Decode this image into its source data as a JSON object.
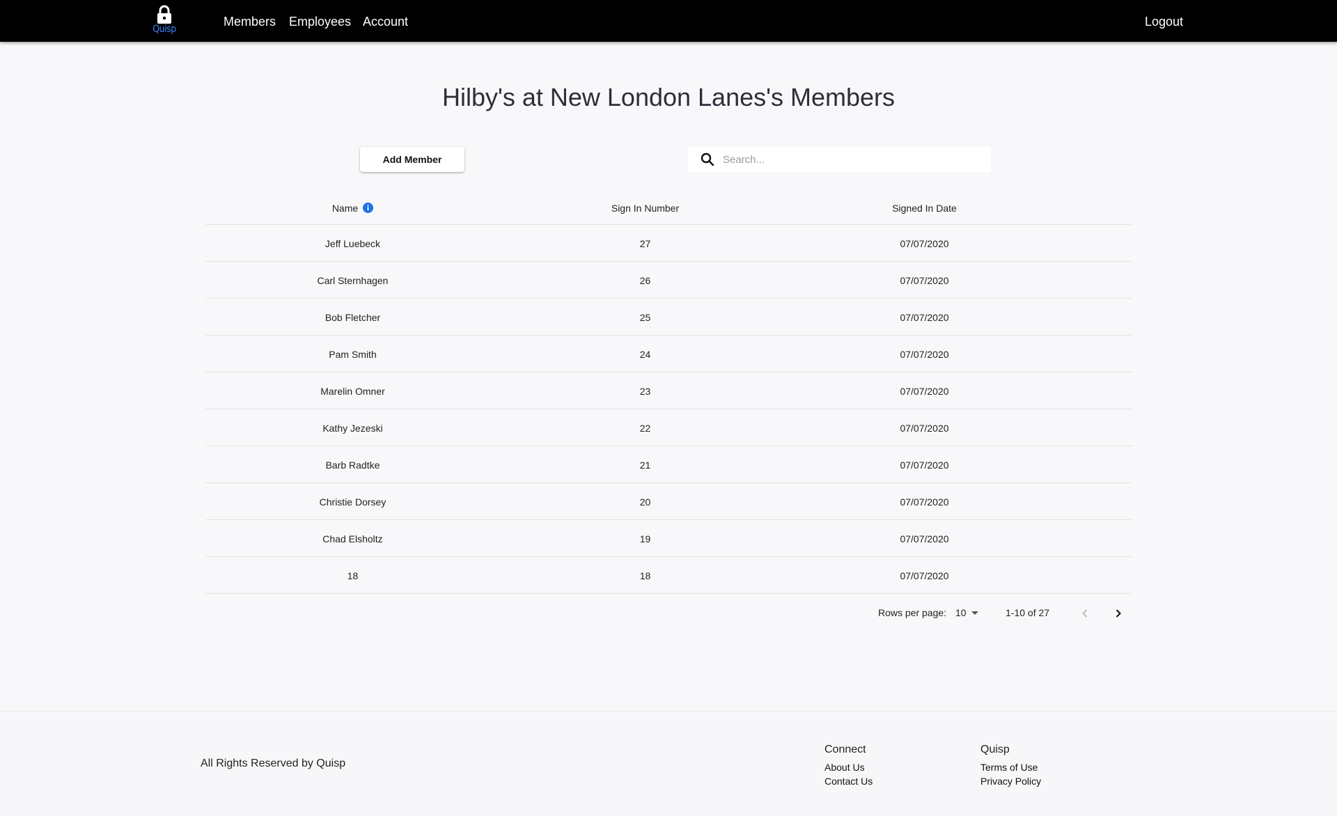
{
  "nav": {
    "logo_text": "Quisp",
    "links": [
      "Members",
      "Employees",
      "Account"
    ],
    "logout_label": "Logout"
  },
  "page": {
    "title": "Hilby's at New London Lanes's Members",
    "add_button_label": "Add Member",
    "search_placeholder": "Search..."
  },
  "table": {
    "headers": {
      "name": "Name",
      "sign_in_number": "Sign In Number",
      "signed_in_date": "Signed In Date"
    },
    "rows": [
      {
        "name": "Jeff Luebeck",
        "number": "27",
        "date": "07/07/2020"
      },
      {
        "name": "Carl Sternhagen",
        "number": "26",
        "date": "07/07/2020"
      },
      {
        "name": "Bob Fletcher",
        "number": "25",
        "date": "07/07/2020"
      },
      {
        "name": "Pam Smith",
        "number": "24",
        "date": "07/07/2020"
      },
      {
        "name": "Marelin Omner",
        "number": "23",
        "date": "07/07/2020"
      },
      {
        "name": "Kathy Jezeski",
        "number": "22",
        "date": "07/07/2020"
      },
      {
        "name": "Barb Radtke",
        "number": "21",
        "date": "07/07/2020"
      },
      {
        "name": "Christie Dorsey",
        "number": "20",
        "date": "07/07/2020"
      },
      {
        "name": "Chad Elsholtz",
        "number": "19",
        "date": "07/07/2020"
      },
      {
        "name": "18",
        "number": "18",
        "date": "07/07/2020"
      }
    ]
  },
  "pagination": {
    "rows_per_page_label": "Rows per page:",
    "rows_per_page_value": "10",
    "range_text": "1-10 of 27"
  },
  "footer": {
    "copyright": "All Rights Reserved by Quisp",
    "connect_heading": "Connect",
    "connect_links": [
      "About Us",
      "Contact Us"
    ],
    "quisp_heading": "Quisp",
    "quisp_links": [
      "Terms of Use",
      "Privacy Policy"
    ]
  },
  "colors": {
    "nav_bg": "#000000",
    "logo_text": "#3b82f6",
    "info_icon": "#1a73e8",
    "page_bg": "#f8f8fa"
  },
  "icons": [
    "lock-icon",
    "search-icon",
    "info-icon",
    "dropdown-arrow-icon",
    "chevron-left-icon",
    "chevron-right-icon"
  ]
}
